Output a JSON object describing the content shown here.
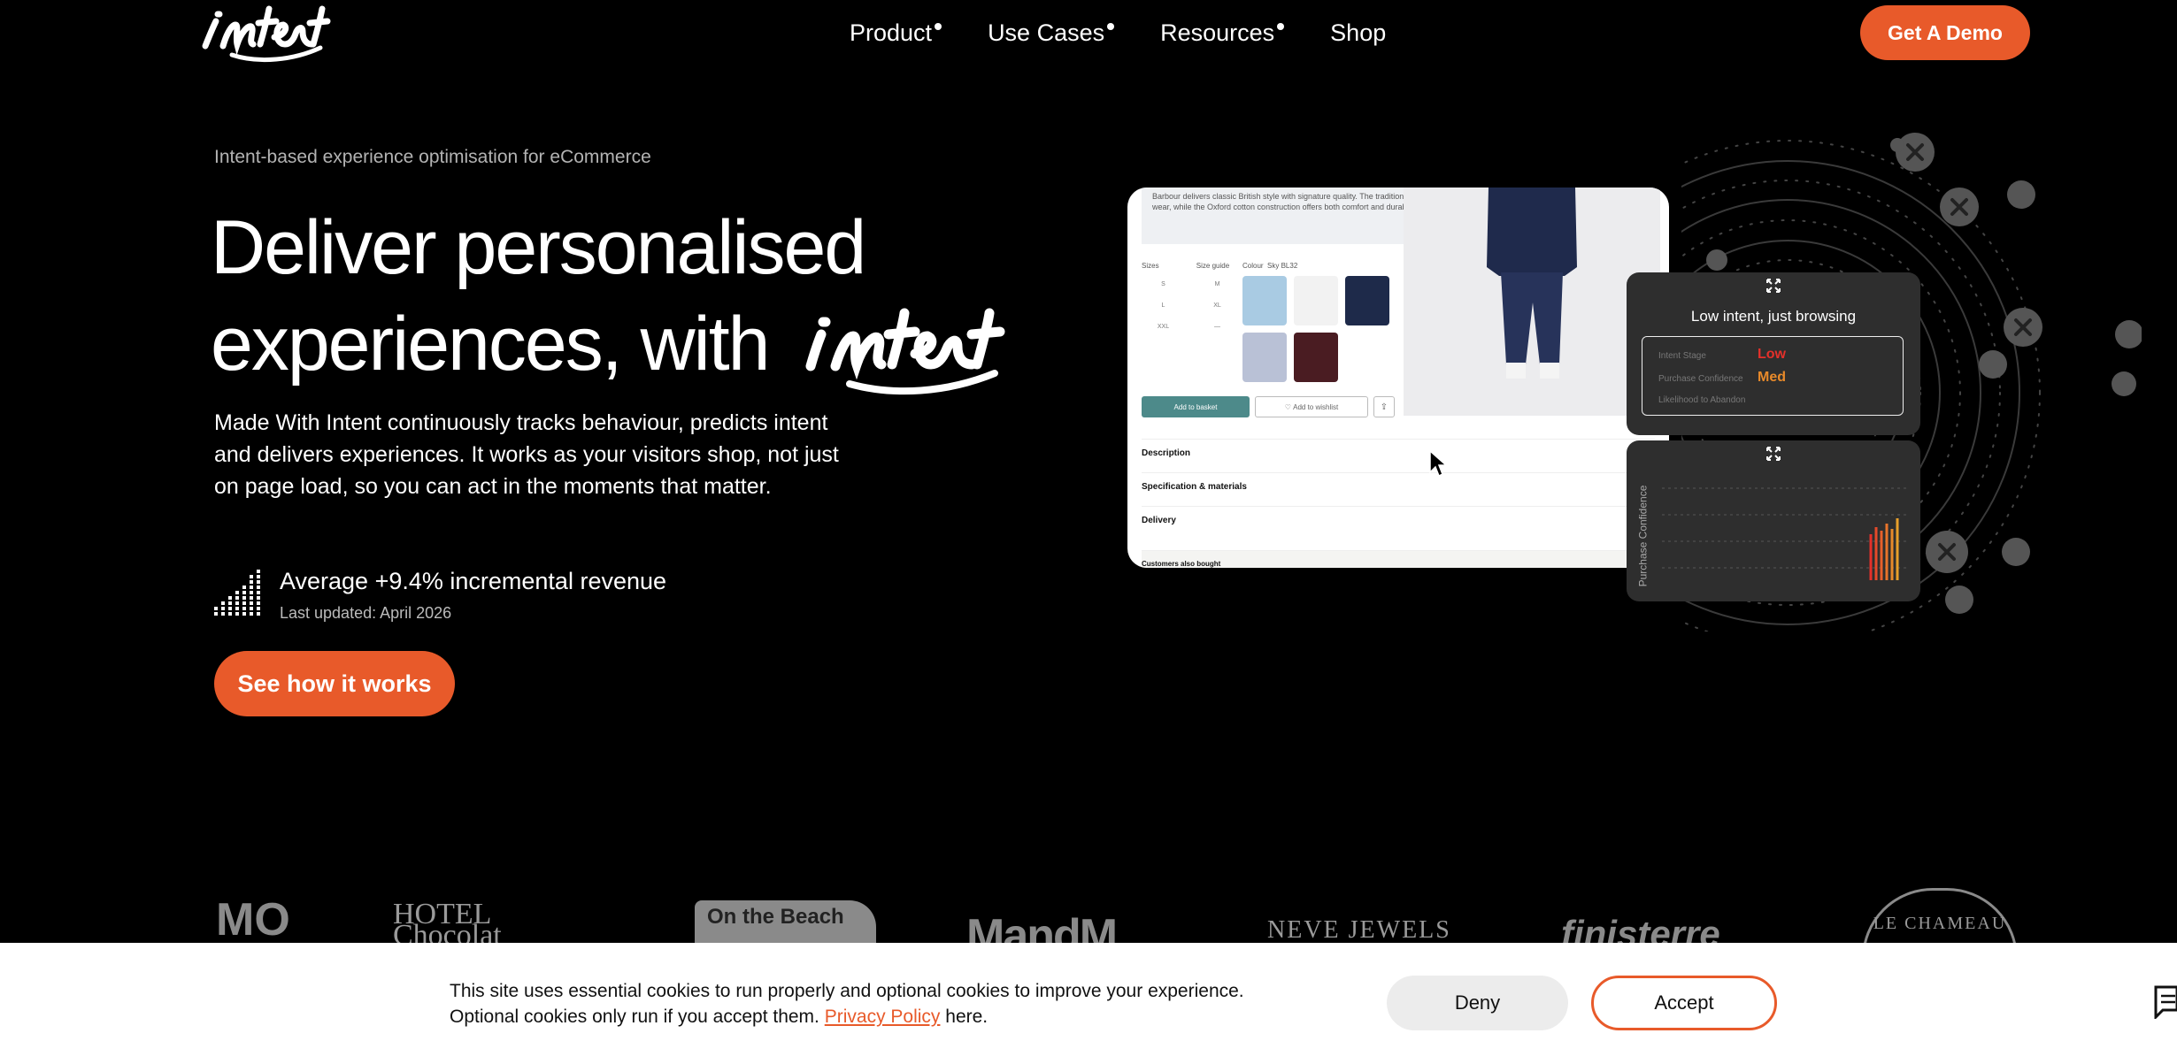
{
  "brand": {
    "logo_text": "intent",
    "accent": "#e85a2a"
  },
  "nav": {
    "items": [
      {
        "label": "Product",
        "has_dot": true
      },
      {
        "label": "Use Cases",
        "has_dot": true
      },
      {
        "label": "Resources",
        "has_dot": true
      },
      {
        "label": "Shop",
        "has_dot": false
      }
    ],
    "cta_label": "Get A Demo"
  },
  "hero": {
    "eyebrow": "Intent-based experience optimisation for eCommerce",
    "headline_line1": "Deliver personalised",
    "headline_line2": "experiences, with",
    "headline_script": "intent",
    "body": "Made With Intent continuously tracks behaviour, predicts intent and delivers experiences. It works as your visitors shop, not just on page load, so you can act in the moments that matter.",
    "stat_title": "Average +9.4% incremental revenue",
    "stat_sub": "Last updated: April 2026",
    "cta_label": "See how it works"
  },
  "mockup": {
    "description": "Barbour delivers classic British style with signature quality. The traditional button-down collar maintains a crisp appearance throughout wear, while the Oxford cotton construction offers both comfort and durability for everyday use.",
    "sizes_label": "Sizes",
    "size_guide": "Size guide",
    "sizes": [
      "S",
      "M",
      "L",
      "XL",
      "XXL",
      "—"
    ],
    "colour_label": "Colour",
    "colour_value": "Sky BL32",
    "swatches": [
      "#a9cbe3",
      "#f2f2f2",
      "#1e2a4a",
      "#b9c1d6",
      "#4a1c22"
    ],
    "add_to_basket": "Add to basket",
    "add_to_wishlist": "Add to wishlist",
    "rows": [
      "Description",
      "Specification & materials",
      "Delivery",
      "Customers also bought"
    ]
  },
  "intent_panel": {
    "title": "Low intent, just browsing",
    "rows": [
      {
        "label": "Intent Stage",
        "value": "Low",
        "color": "#e5302a"
      },
      {
        "label": "Purchase Confidence",
        "value": "Med",
        "color": "#e88a2a"
      },
      {
        "label": "Likelihood to Abandon",
        "value": ""
      }
    ]
  },
  "confidence_panel": {
    "ylabel": "Purchase Confidence"
  },
  "logos": [
    "MO",
    "HOTEL Chocolat",
    "On the Beach",
    "MandM",
    "NEVE JEWELS",
    "finisterre",
    "LE CHAMEAU"
  ],
  "cookie": {
    "text_before": "This site uses essential cookies to run properly and optional cookies to improve your experience. Optional cookies only run if you accept them.",
    "link": "Privacy Policy",
    "text_after": "here.",
    "deny": "Deny",
    "accept": "Accept"
  }
}
